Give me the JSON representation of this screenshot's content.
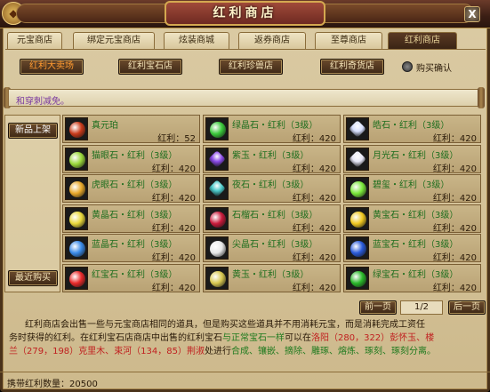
{
  "window": {
    "title": "红利商店",
    "close_label": "X"
  },
  "tabs": [
    {
      "label": "元宝商店",
      "active": false
    },
    {
      "label": "绑定元宝商店",
      "active": false
    },
    {
      "label": "炫装商城",
      "active": false
    },
    {
      "label": "返券商店",
      "active": false
    },
    {
      "label": "至尊商店",
      "active": false
    },
    {
      "label": "红利商店",
      "active": true
    }
  ],
  "categories": [
    {
      "label": "红利大卖场",
      "active": true
    },
    {
      "label": "红利宝石店",
      "active": false
    },
    {
      "label": "红利珍兽店",
      "active": false
    },
    {
      "label": "红利奇货店",
      "active": false
    }
  ],
  "purchase_confirm": {
    "label": "购买确认"
  },
  "notice": {
    "text": "和穿刺减免。"
  },
  "sidebar": {
    "top_button": "新品上架",
    "bottom_button": "最近购买"
  },
  "items": [
    {
      "name": "真元珀",
      "price": "红利：52",
      "color": "#c83a1a",
      "shape": "round"
    },
    {
      "name": "绿晶石・红利（3级）",
      "price": "红利：420",
      "color": "#3ac83a",
      "shape": "round"
    },
    {
      "name": "皓石・红利（3级）",
      "price": "红利：420",
      "color": "#d8e0ff",
      "shape": "sq"
    },
    {
      "name": "猫眼石・红利（3级）",
      "price": "红利：420",
      "color": "#9ad83a",
      "shape": "round"
    },
    {
      "name": "紫玉・红利（3级）",
      "price": "红利：420",
      "color": "#8a4ae8",
      "shape": "sq"
    },
    {
      "name": "月光石・红利（3级）",
      "price": "红利：420",
      "color": "#e8e8f8",
      "shape": "sq"
    },
    {
      "name": "虎眼石・红利（3级）",
      "price": "红利：420",
      "color": "#e8a82a",
      "shape": "round"
    },
    {
      "name": "夜石・红利（3级）",
      "price": "红利：420",
      "color": "#4ac8c8",
      "shape": "sq"
    },
    {
      "name": "碧玺・红利（3级）",
      "price": "红利：420",
      "color": "#7ae83a",
      "shape": "round"
    },
    {
      "name": "黄晶石・红利（3级）",
      "price": "红利：420",
      "color": "#e8d83a",
      "shape": "round"
    },
    {
      "name": "石榴石・红利（3级）",
      "price": "红利：420",
      "color": "#c81a3a",
      "shape": "round"
    },
    {
      "name": "黄宝石・红利（3级）",
      "price": "红利：420",
      "color": "#f0c820",
      "shape": "round"
    },
    {
      "name": "蓝晶石・红利（3级）",
      "price": "红利：420",
      "color": "#3a8ae8",
      "shape": "round"
    },
    {
      "name": "尖晶石・红利（3级）",
      "price": "红利：420",
      "color": "#e8e8e8",
      "shape": "round"
    },
    {
      "name": "蓝宝石・红利（3级）",
      "price": "红利：420",
      "color": "#2a5ad8",
      "shape": "round"
    },
    {
      "name": "红宝石・红利（3级）",
      "price": "红利：420",
      "color": "#e82a2a",
      "shape": "round"
    },
    {
      "name": "黄玉・红利（3级）",
      "price": "红利：420",
      "color": "#d8c850",
      "shape": "round"
    },
    {
      "name": "绿宝石・红利（3级）",
      "price": "红利：420",
      "color": "#2ab82a",
      "shape": "round"
    }
  ],
  "pager": {
    "prev": "前一页",
    "indicator": "1/2",
    "next": "后一页"
  },
  "description": {
    "p1": "红利商店会出售一些与元宝商店相同的道具，但是购买这些道具并不用消耗元宝，而是消耗完成工资任",
    "p2a": "务时获得的红利。在红利宝石店商店中出售的红利宝石",
    "p2b": "与正常宝石一样",
    "p2c": "可以在",
    "p2d": "洛阳（280，322）",
    "p2e": "彭怀玉、",
    "p2f": "楼",
    "p3a": "兰（279，198）",
    "p3b": "克里木、",
    "p3c": "束河（134，85）",
    "p3d": "荆淑",
    "p3e": "处进行",
    "p3f": "合成、镶嵌、摘除、雕琢、熔炼、琢刻、琢刻分离。"
  },
  "footer": {
    "label": "携带红利数量：20500"
  }
}
